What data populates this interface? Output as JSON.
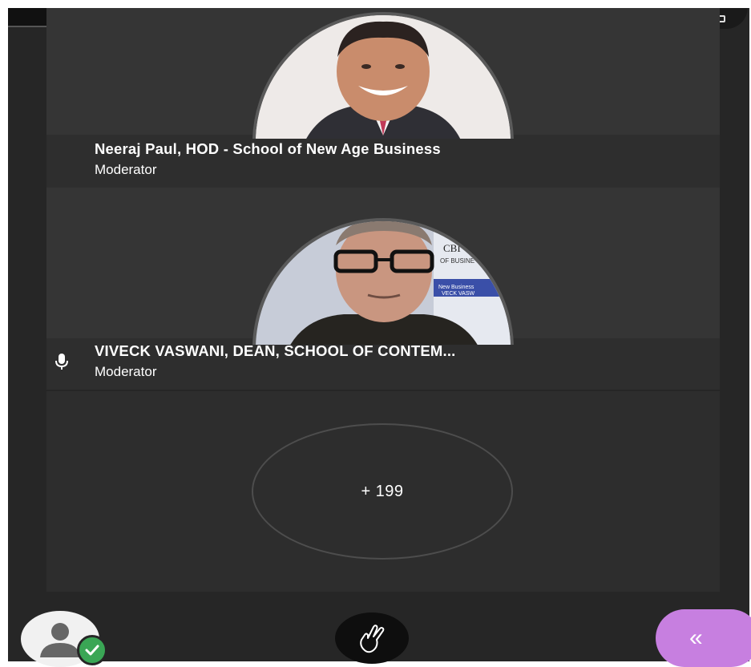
{
  "participants": [
    {
      "name": "Neeraj Paul, HOD - School of New Age Business",
      "role": "Moderator",
      "mic": false
    },
    {
      "name": "VIVECK VASWANI, DEAN, SCHOOL OF CONTEM...",
      "role": "Moderator",
      "mic": true
    }
  ],
  "more_participants": {
    "label": "+ 199"
  },
  "toolbar": {
    "collapse_glyph": "«",
    "icons": [
      "camera-icon",
      "more-icon",
      "user-icon",
      "check-icon",
      "raise-hand-icon",
      "collapse-icon"
    ]
  },
  "colors": {
    "background": "#262626",
    "tile": "#353535",
    "status_ok": "#3aa655",
    "accent": "#c77fe0",
    "camera_red": "#e0312f"
  }
}
